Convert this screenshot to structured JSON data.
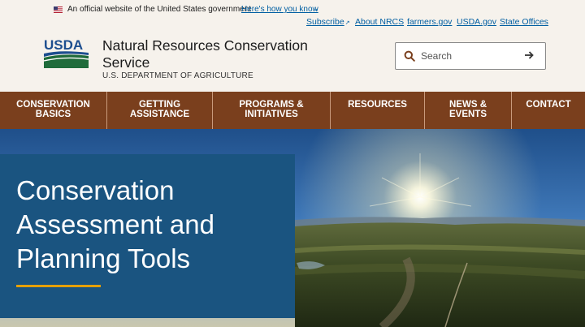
{
  "banner": {
    "text": "An official website of the United States government",
    "link": "Here's how you know",
    "chevron": "⌄"
  },
  "utility_links": {
    "subscribe": "Subscribe",
    "about": "About NRCS",
    "farmers": "farmers.gov",
    "usda": "USDA.gov",
    "state_offices": "State Offices"
  },
  "header": {
    "logo_text": "USDA",
    "agency_name": "Natural Resources Conservation Service",
    "department": "U.S. DEPARTMENT OF AGRICULTURE"
  },
  "search": {
    "placeholder": "Search"
  },
  "nav": {
    "items": [
      {
        "label": "CONSERVATION BASICS"
      },
      {
        "label": "GETTING ASSISTANCE"
      },
      {
        "label": "PROGRAMS & INITIATIVES"
      },
      {
        "label": "RESOURCES"
      },
      {
        "label": "NEWS & EVENTS"
      },
      {
        "label": "CONTACT"
      }
    ]
  },
  "hero": {
    "title": "Conservation Assessment and Planning Tools"
  },
  "colors": {
    "nav_bg": "#7a3f1d",
    "hero_card": "#1a5480",
    "accent_rule": "#e5a000",
    "link": "#005ea2",
    "usda_green": "#1f6b3a",
    "usda_blue": "#1d4e8f"
  }
}
